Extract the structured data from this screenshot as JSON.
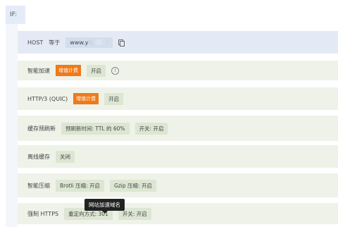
{
  "if_tag": "IF:",
  "host": {
    "label": "HOST",
    "operator": "等于",
    "value": "www.y"
  },
  "rows": {
    "smart_accel": {
      "label": "智能加速",
      "badge": "增值计费",
      "chip": "开启"
    },
    "http3": {
      "label": "HTTP/3 (QUIC)",
      "badge": "增值计费",
      "chip": "开启"
    },
    "prefresh": {
      "label": "缓存预刷新",
      "chip1": "预刷新时间: TTL 的 60%",
      "chip2": "开关: 开启"
    },
    "offline": {
      "label": "离线缓存",
      "chip": "关闭"
    },
    "compress": {
      "label": "智能压缩",
      "chip1": "Brotli 压缩: 开启",
      "chip2": "Gzip 压缩: 开启"
    },
    "https": {
      "label": "强制 HTTPS",
      "chip1": "重定向方式: 301",
      "chip2": "开关: 开启"
    }
  },
  "tooltip": "网站加速域名",
  "colors": {
    "badge": "#ee7a1c",
    "host_row": "#e4eaf5",
    "green_row": "#eef2e8"
  }
}
